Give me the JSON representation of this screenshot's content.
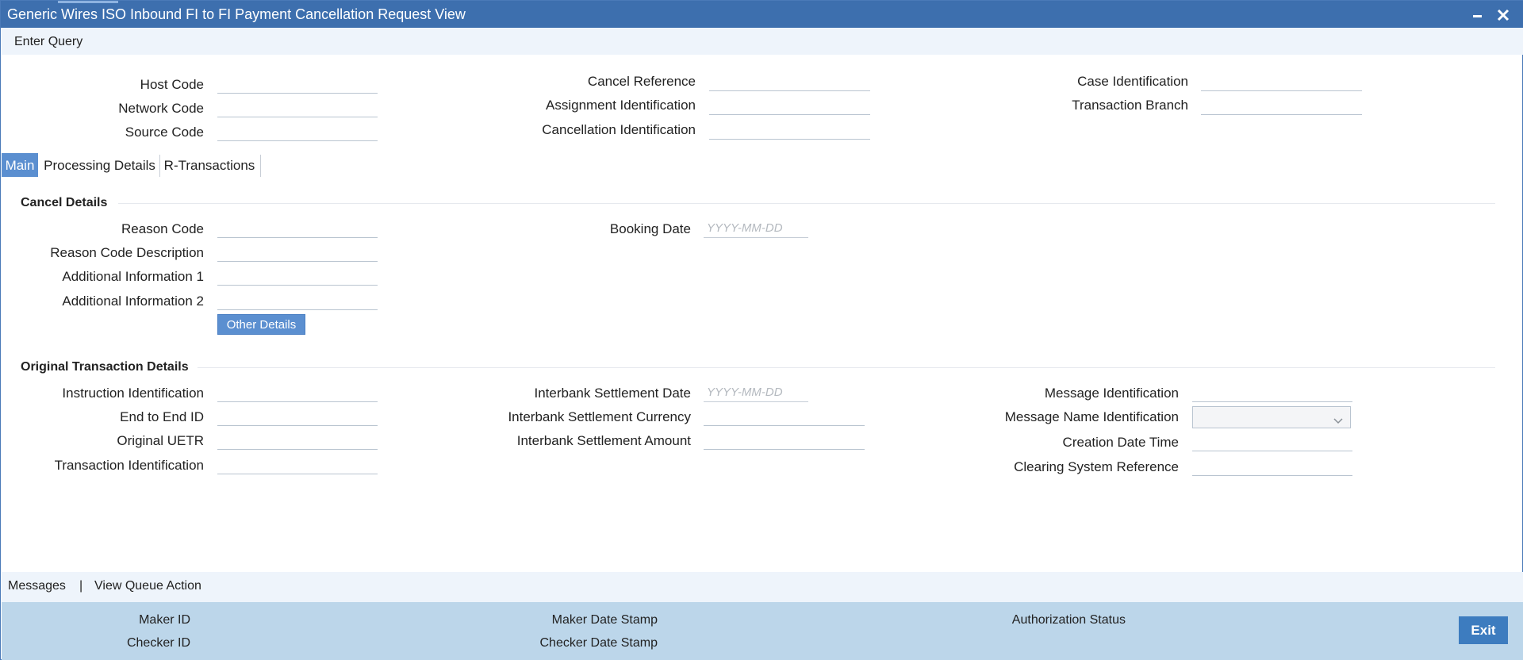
{
  "window": {
    "title": "Generic Wires ISO Inbound FI to FI Payment Cancellation Request View",
    "minimize_icon": "minimize-icon",
    "close_icon": "close-icon"
  },
  "menu": {
    "enter_query": "Enter Query"
  },
  "header": {
    "host_code": {
      "label": "Host Code",
      "value": ""
    },
    "network_code": {
      "label": "Network Code",
      "value": ""
    },
    "source_code": {
      "label": "Source Code",
      "value": ""
    },
    "cancel_reference": {
      "label": "Cancel Reference",
      "value": ""
    },
    "assignment_identification": {
      "label": "Assignment Identification",
      "value": ""
    },
    "cancellation_identification": {
      "label": "Cancellation Identification",
      "value": ""
    },
    "case_identification": {
      "label": "Case Identification",
      "value": ""
    },
    "transaction_branch": {
      "label": "Transaction Branch",
      "value": ""
    }
  },
  "tabs": [
    {
      "label": "Main",
      "active": true
    },
    {
      "label": "Processing Details",
      "active": false
    },
    {
      "label": "R-Transactions",
      "active": false
    }
  ],
  "cancel_details": {
    "title": "Cancel Details",
    "reason_code": {
      "label": "Reason Code",
      "value": ""
    },
    "reason_code_description": {
      "label": "Reason Code Description",
      "value": ""
    },
    "additional_information_1": {
      "label": "Additional Information 1",
      "value": ""
    },
    "additional_information_2": {
      "label": "Additional Information 2",
      "value": ""
    },
    "booking_date": {
      "label": "Booking Date",
      "placeholder": "YYYY-MM-DD",
      "value": ""
    },
    "other_details_button": "Other Details"
  },
  "original_transaction_details": {
    "title": "Original Transaction Details",
    "instruction_identification": {
      "label": "Instruction Identification",
      "value": ""
    },
    "end_to_end_id": {
      "label": "End to End ID",
      "value": ""
    },
    "original_uetr": {
      "label": "Original UETR",
      "value": ""
    },
    "transaction_identification": {
      "label": "Transaction Identification",
      "value": ""
    },
    "interbank_settlement_date": {
      "label": "Interbank Settlement Date",
      "placeholder": "YYYY-MM-DD",
      "value": ""
    },
    "interbank_settlement_currency": {
      "label": "Interbank Settlement Currency",
      "value": ""
    },
    "interbank_settlement_amount": {
      "label": "Interbank Settlement Amount",
      "value": ""
    },
    "message_identification": {
      "label": "Message Identification",
      "value": ""
    },
    "message_name_identification": {
      "label": "Message Name Identification",
      "value": ""
    },
    "creation_date_time": {
      "label": "Creation Date Time",
      "value": ""
    },
    "clearing_system_reference": {
      "label": "Clearing System Reference",
      "value": ""
    }
  },
  "message_bar": {
    "messages": "Messages",
    "separator": "|",
    "view_queue_action": "View Queue Action"
  },
  "footer": {
    "maker_id": "Maker ID",
    "checker_id": "Checker ID",
    "maker_date_stamp": "Maker Date Stamp",
    "checker_date_stamp": "Checker Date Stamp",
    "authorization_status": "Authorization Status",
    "exit_button": "Exit"
  },
  "colors": {
    "titlebar": "#3d6fae",
    "accent": "#5b8fd0",
    "footer": "#bcd6ea",
    "exit_button": "#3d7cbf"
  }
}
